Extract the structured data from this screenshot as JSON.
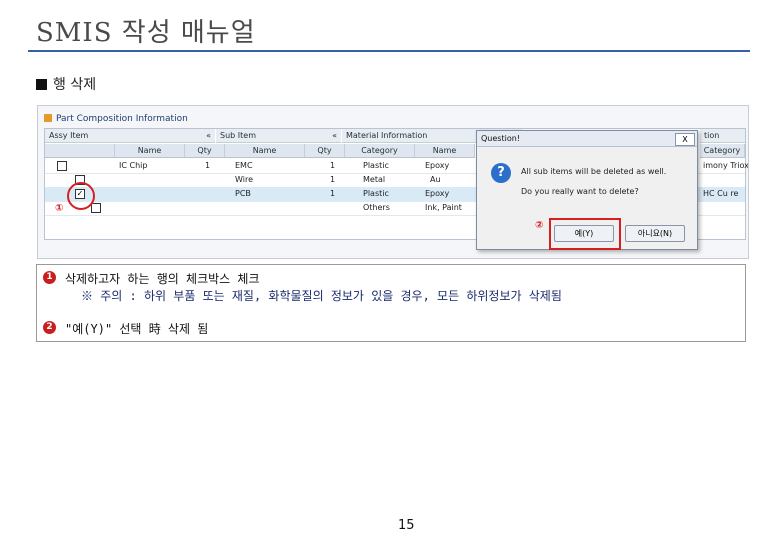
{
  "page": {
    "title": "SMIS 작성 매뉴얼",
    "section": "행 삭제",
    "page_number": "15"
  },
  "panel": {
    "title": "Part Composition Information",
    "groups": [
      "Assy Item",
      "Sub Item",
      "Material Information",
      "tion"
    ],
    "headers": [
      "Name",
      "Qty",
      "Name",
      "Qty",
      "Category",
      "Name",
      "Category"
    ],
    "rows": [
      {
        "assy_name": "IC Chip",
        "assy_qty": "1",
        "sub_name": "EMC",
        "sub_qty": "1",
        "category": "Plastic",
        "mat_name": "Epoxy",
        "right": "imony Triox"
      },
      {
        "assy_name": "",
        "assy_qty": "",
        "sub_name": "Wire",
        "sub_qty": "1",
        "category": "Metal",
        "mat_name": "Au",
        "right": ""
      },
      {
        "assy_name": "",
        "assy_qty": "",
        "sub_name": "PCB",
        "sub_qty": "1",
        "category": "Plastic",
        "mat_name": "Epoxy",
        "right": "HC Cu re"
      },
      {
        "assy_name": "",
        "assy_qty": "",
        "sub_name": "",
        "sub_qty": "",
        "category": "Others",
        "mat_name": "Ink, Paint",
        "right": ""
      }
    ],
    "marker_1": "①",
    "marker_2": "②"
  },
  "dialog": {
    "title": "Question!",
    "close": "X",
    "icon": "?",
    "line1": "All sub items will be deleted as well.",
    "line2": "Do you really want to delete?",
    "yes": "예(Y)",
    "no": "아니요(N)"
  },
  "instructions": {
    "step1_num": "1",
    "step1": "삭제하고자 하는 행의 체크박스 체크",
    "note": "※ 주의 : 하위 부품 또는 재질, 화학물질의 정보가 있을 경우, 모든 하위정보가 삭제됨",
    "step2_num": "2",
    "step2": "\"예(Y)\" 선택 時 삭제 됨"
  },
  "colors": {
    "accent": "#3a5fa8",
    "highlight": "#d42020",
    "selected_row": "#d9eaf7"
  }
}
